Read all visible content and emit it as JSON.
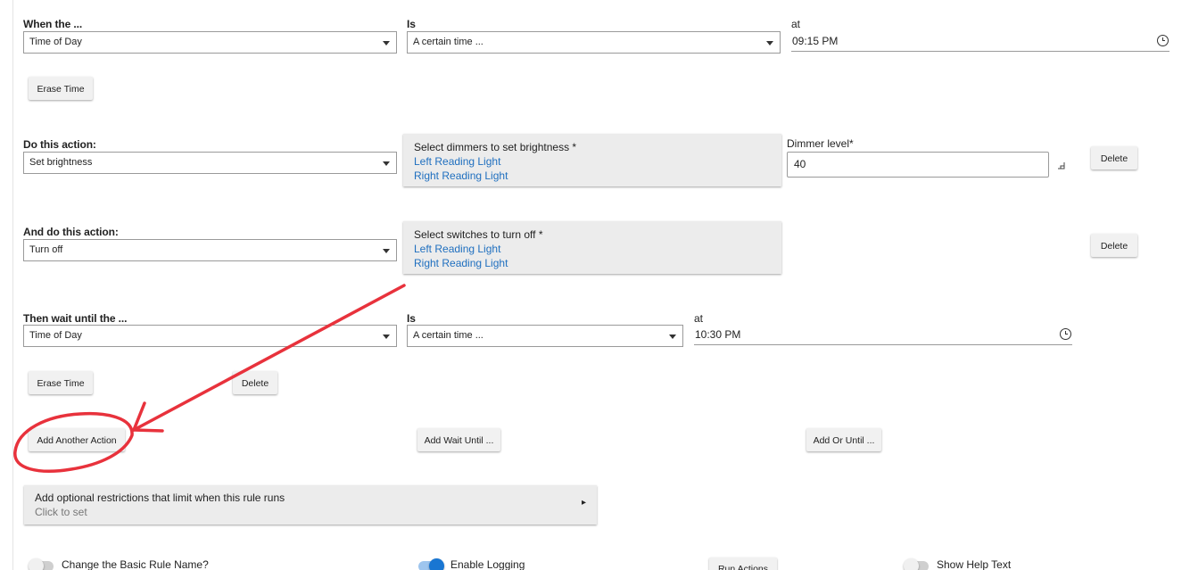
{
  "trigger": {
    "when_label": "When the ...",
    "when_value": "Time of Day",
    "is_label": "Is",
    "is_value": "A certain time ...",
    "at_label": "at",
    "at_value": "09:15 PM",
    "erase_label": "Erase Time"
  },
  "action1": {
    "label": "Do this action:",
    "value": "Set brightness",
    "panel_title": "Select dimmers to set brightness *",
    "devices": [
      "Left Reading Light",
      "Right Reading Light"
    ],
    "dimmer_label": "Dimmer level*",
    "dimmer_value": "40",
    "delete_label": "Delete"
  },
  "action2": {
    "label": "And do this action:",
    "value": "Turn off",
    "panel_title": "Select switches to turn off *",
    "devices": [
      "Left Reading Light",
      "Right Reading Light"
    ],
    "delete_label": "Delete"
  },
  "wait": {
    "label": "Then wait until the ...",
    "value": "Time of Day",
    "is_label": "Is",
    "is_value": "A certain time ...",
    "at_label": "at",
    "at_value": "10:30 PM",
    "erase_label": "Erase Time",
    "delete_label": "Delete"
  },
  "buttons": {
    "add_action": "Add Another Action",
    "add_wait": "Add Wait Until ...",
    "add_or_until": "Add Or Until ..."
  },
  "restrictions": {
    "title": "Add optional restrictions that limit when this rule runs",
    "subtitle": "Click to set",
    "arrow": "▸"
  },
  "footer": {
    "change_name_label": "Change the Basic Rule Name?",
    "change_name_on": false,
    "logging_label": "Enable Logging",
    "logging_on": true,
    "run_actions_label": "Run Actions",
    "help_text_label": "Show Help Text",
    "help_text_on": false
  },
  "annotation": {
    "color": "#e8323c"
  }
}
